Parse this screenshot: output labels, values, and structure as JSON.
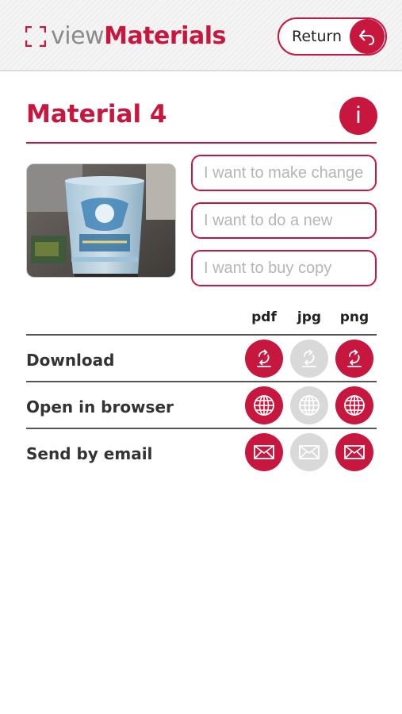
{
  "header": {
    "logo_view": "view",
    "logo_materials": "Materials",
    "return_label": "Return"
  },
  "material": {
    "title": "Material 4",
    "info_label": "i"
  },
  "requests": [
    {
      "placeholder": "I want to make changes"
    },
    {
      "placeholder": "I want to do a new"
    },
    {
      "placeholder": "I want to buy copy"
    }
  ],
  "formats": {
    "columns": [
      "pdf",
      "jpg",
      "png"
    ],
    "rows": [
      {
        "label": "Download",
        "icon": "download-icon",
        "available": [
          true,
          false,
          true
        ]
      },
      {
        "label": "Open in browser",
        "icon": "globe-icon",
        "available": [
          true,
          false,
          true
        ]
      },
      {
        "label": "Send by email",
        "icon": "envelope-icon",
        "available": [
          true,
          false,
          true
        ]
      }
    ]
  },
  "colors": {
    "accent": "#c8173f",
    "disabled": "#d9d9d9",
    "text": "#333333",
    "placeholder": "#b5b5b5"
  }
}
